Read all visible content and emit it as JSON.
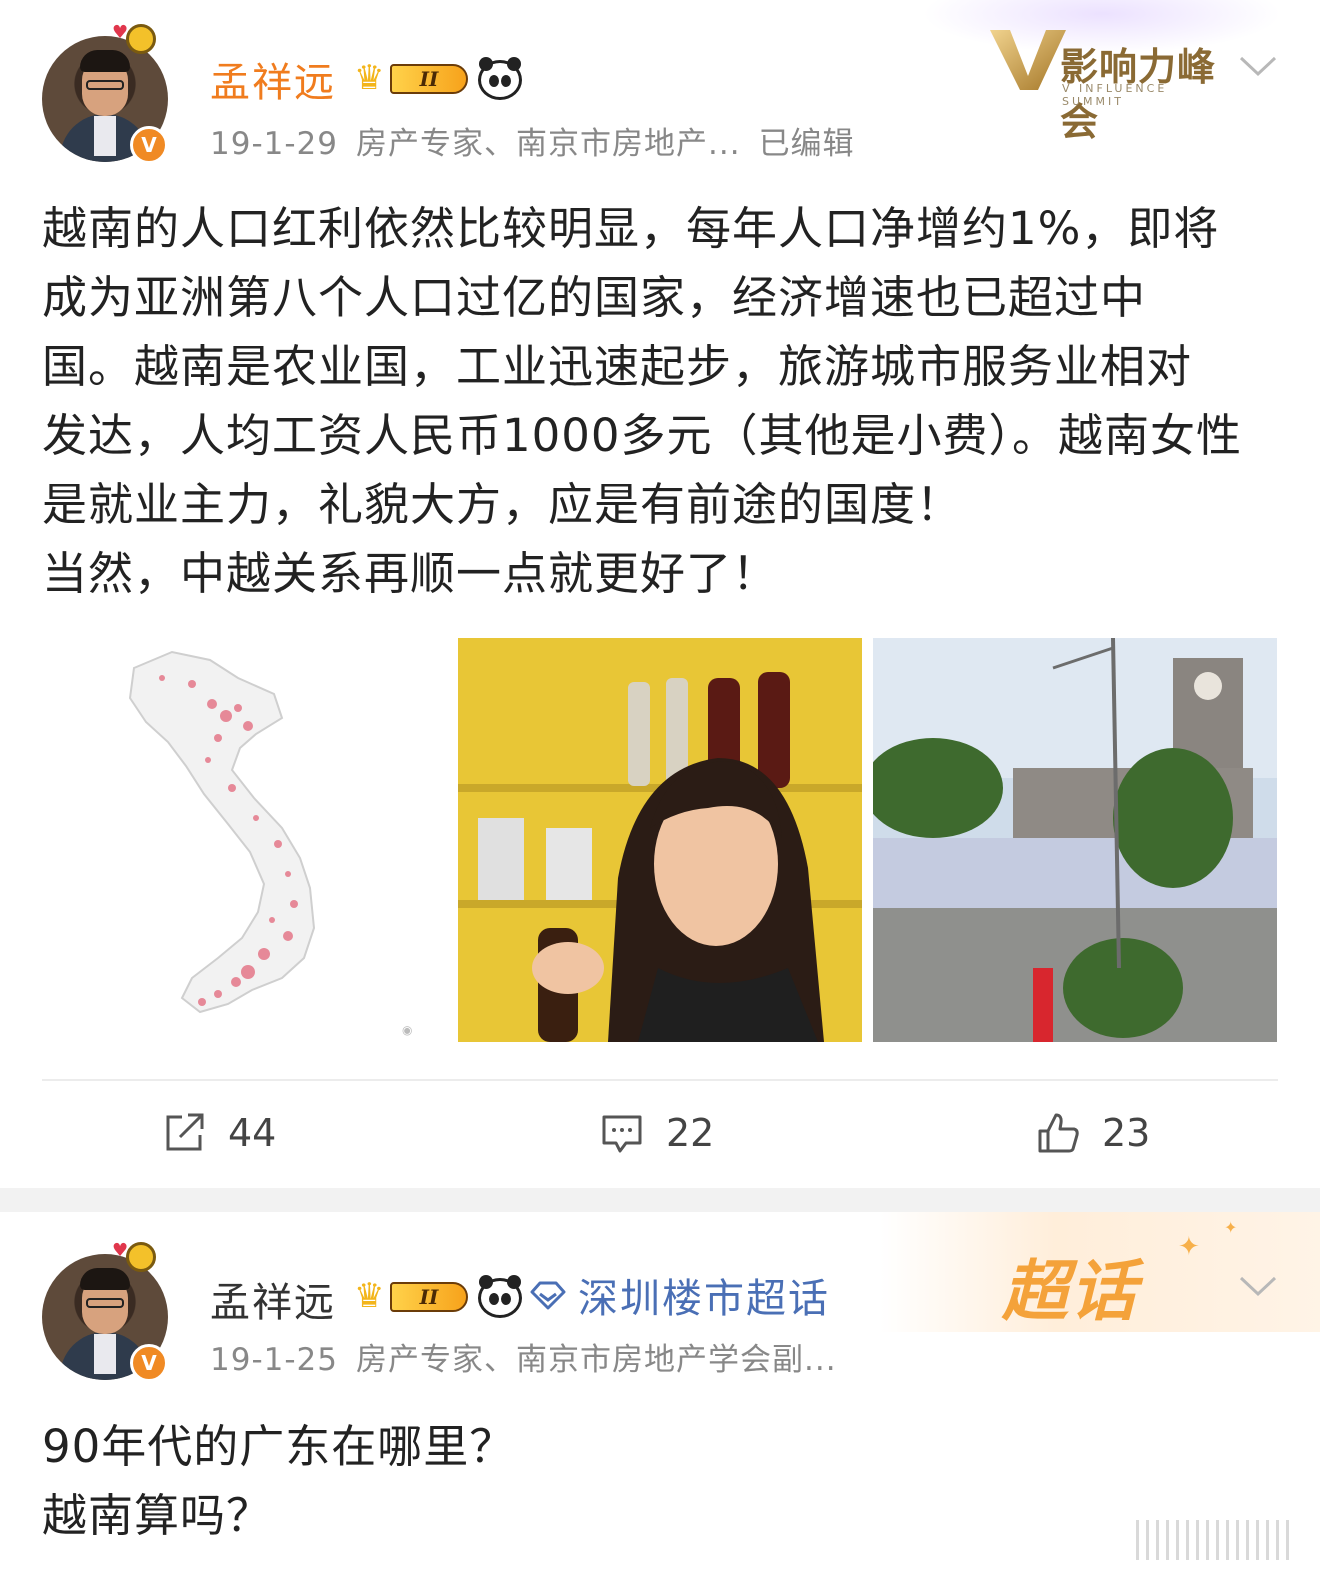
{
  "post1": {
    "username": "孟祥远",
    "level_badge": "II",
    "verified_mark": "V",
    "meta": {
      "date": "19-1-29",
      "bio": "房产专家、南京市房地产...",
      "edited": "已编辑"
    },
    "brand": {
      "title": "影响力峰会",
      "subtitle": "V INFLUENCE SUMMIT"
    },
    "content_lines": [
      "越南的人口红利依然比较明显，每年人口净增约1%，即将",
      "成为亚洲第八个人口过亿的国家，经济增速也已超过中",
      "国。越南是农业国，工业迅速起步，旅游城市服务业相对",
      "发达，人均工资人民币1000多元（其他是小费）。越南女性",
      "是就业主力，礼貌大方，应是有前途的国度！",
      "当然，中越关系再顺一点就更好了！"
    ],
    "images": [
      "vietnam-population-map",
      "woman-at-bar-photo",
      "cathedral-photo"
    ],
    "actions": {
      "repost_count": "44",
      "comment_count": "22",
      "like_count": "23"
    }
  },
  "post2": {
    "username": "孟祥远",
    "level_badge": "II",
    "verified_mark": "V",
    "topic_link": "深圳楼市超话",
    "chaohua_label": "超话",
    "meta": {
      "date": "19-1-25",
      "bio": "房产专家、南京市房地产学会副..."
    },
    "content_lines": [
      "90年代的广东在哪里？",
      "越南算吗？"
    ]
  },
  "colors": {
    "username_orange": "#f07c1e",
    "link_blue": "#4a6fb5",
    "meta_gray": "#888888",
    "verified_orange": "#f08a24"
  }
}
